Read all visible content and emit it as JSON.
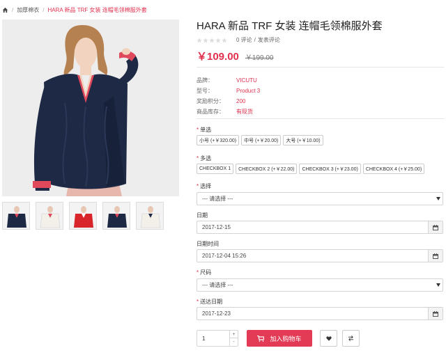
{
  "breadcrumb": {
    "items": [
      "加厚棉衣",
      "HARA 新品 TRF 女装 连帽毛领棉服外套"
    ]
  },
  "product": {
    "title": "HARA 新品 TRF 女装 连帽毛领棉服外套",
    "rating": 0,
    "reviews_text": "0 评论",
    "write_review": "发表评论",
    "price": "￥109.00",
    "old_price": "￥199.00",
    "info": [
      {
        "label": "品牌：",
        "value": "VICUTU"
      },
      {
        "label": "型号：",
        "value": "Product 3"
      },
      {
        "label": "奖励积分：",
        "value": "200"
      },
      {
        "label": "商品库存：",
        "value": "有现货"
      }
    ]
  },
  "options": {
    "radio": {
      "label": "单选",
      "items": [
        "小号 (+￥320.00)",
        "中号 (+￥20.00)",
        "大号 (+￥10.00)"
      ]
    },
    "checkbox": {
      "label": "多选",
      "items": [
        "CHECKBOX 1",
        "CHECKBOX 2 (+￥22.00)",
        "CHECKBOX 3 (+￥23.00)",
        "CHECKBOX 4 (+￥25.00)"
      ]
    },
    "select": {
      "label": "选择",
      "value": "--- 请选择 ---"
    },
    "date": {
      "label": "日期",
      "value": "2017-12-15"
    },
    "datetime": {
      "label": "日期时间",
      "value": "2017-12-04 15:26"
    },
    "size": {
      "label": "尺码",
      "value": "--- 请选择 ---"
    },
    "delivery": {
      "label": "送达日期",
      "value": "2017-12-23"
    }
  },
  "cart": {
    "quantity": "1",
    "add_label": "加入购物车"
  },
  "colors": {
    "accent": "#e33a55",
    "sweater": "#1e2a45",
    "stripe": "#e0485c"
  },
  "thumbnails": [
    {
      "sweater_color": "#1e2a45"
    },
    {
      "sweater_color": "#f3f0ea"
    },
    {
      "sweater_color": "#d8242b"
    },
    {
      "sweater_color": "#1e2a45"
    },
    {
      "sweater_color": "#f3f0ea"
    }
  ]
}
